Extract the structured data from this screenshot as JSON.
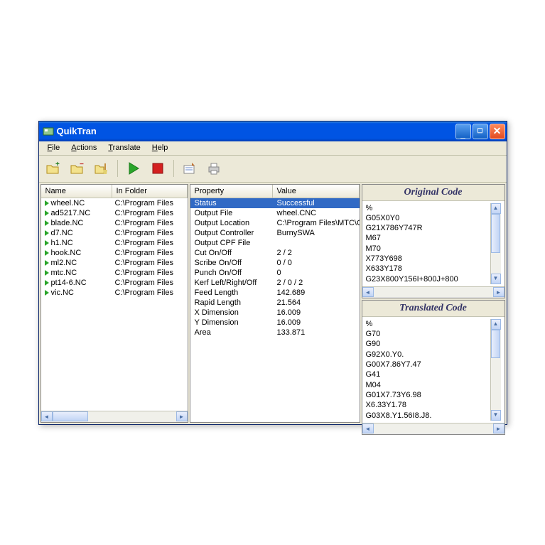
{
  "window": {
    "title": "QuikTran"
  },
  "menus": {
    "file": "File",
    "actions": "Actions",
    "translate": "Translate",
    "help": "Help"
  },
  "toolbar_icons": [
    "add-folder",
    "remove-folder",
    "clean-folder",
    "run",
    "stop",
    "options",
    "print"
  ],
  "file_list": {
    "headers": {
      "name": "Name",
      "folder": "In Folder"
    },
    "rows": [
      {
        "name": "wheel.NC",
        "folder": "C:\\Program Files"
      },
      {
        "name": "ad5217.NC",
        "folder": "C:\\Program Files"
      },
      {
        "name": "blade.NC",
        "folder": "C:\\Program Files"
      },
      {
        "name": "d7.NC",
        "folder": "C:\\Program Files"
      },
      {
        "name": "h1.NC",
        "folder": "C:\\Program Files"
      },
      {
        "name": "hook.NC",
        "folder": "C:\\Program Files"
      },
      {
        "name": "ml2.NC",
        "folder": "C:\\Program Files"
      },
      {
        "name": "mtc.NC",
        "folder": "C:\\Program Files"
      },
      {
        "name": "pt14-6.NC",
        "folder": "C:\\Program Files"
      },
      {
        "name": "vic.NC",
        "folder": "C:\\Program Files"
      }
    ]
  },
  "properties": {
    "headers": {
      "property": "Property",
      "value": "Value"
    },
    "rows": [
      {
        "property": "Status",
        "value": "Successful",
        "selected": true
      },
      {
        "property": "Output File",
        "value": "wheel.CNC"
      },
      {
        "property": "Output Location",
        "value": "C:\\Program Files\\MTC\\C"
      },
      {
        "property": "Output Controller",
        "value": "BurnySWA"
      },
      {
        "property": "Output CPF File",
        "value": ""
      },
      {
        "property": "Cut On/Off",
        "value": "2 / 2"
      },
      {
        "property": "Scribe On/Off",
        "value": "0 / 0"
      },
      {
        "property": "Punch On/Off",
        "value": "0"
      },
      {
        "property": "Kerf Left/Right/Off",
        "value": "2 / 0 / 2"
      },
      {
        "property": "Feed Length",
        "value": "142.689"
      },
      {
        "property": "Rapid Length",
        "value": "21.564"
      },
      {
        "property": "X Dimension",
        "value": "16.009"
      },
      {
        "property": "Y Dimension",
        "value": "16.009"
      },
      {
        "property": "Area",
        "value": "133.871"
      }
    ]
  },
  "code_panels": {
    "original": {
      "title": "Original Code",
      "lines": [
        "%",
        "G05X0Y0",
        "G21X786Y747R",
        "M67",
        "M70",
        "X773Y698",
        "X633Y178",
        "G23X800Y156I+800J+800"
      ]
    },
    "translated": {
      "title": "Translated Code",
      "lines": [
        "%",
        "G70",
        "G90",
        "G92X0.Y0.",
        "G00X7.86Y7.47",
        "G41",
        "M04",
        "G01X7.73Y6.98",
        "X6.33Y1.78",
        "G03X8.Y1.56I8.J8."
      ]
    }
  }
}
